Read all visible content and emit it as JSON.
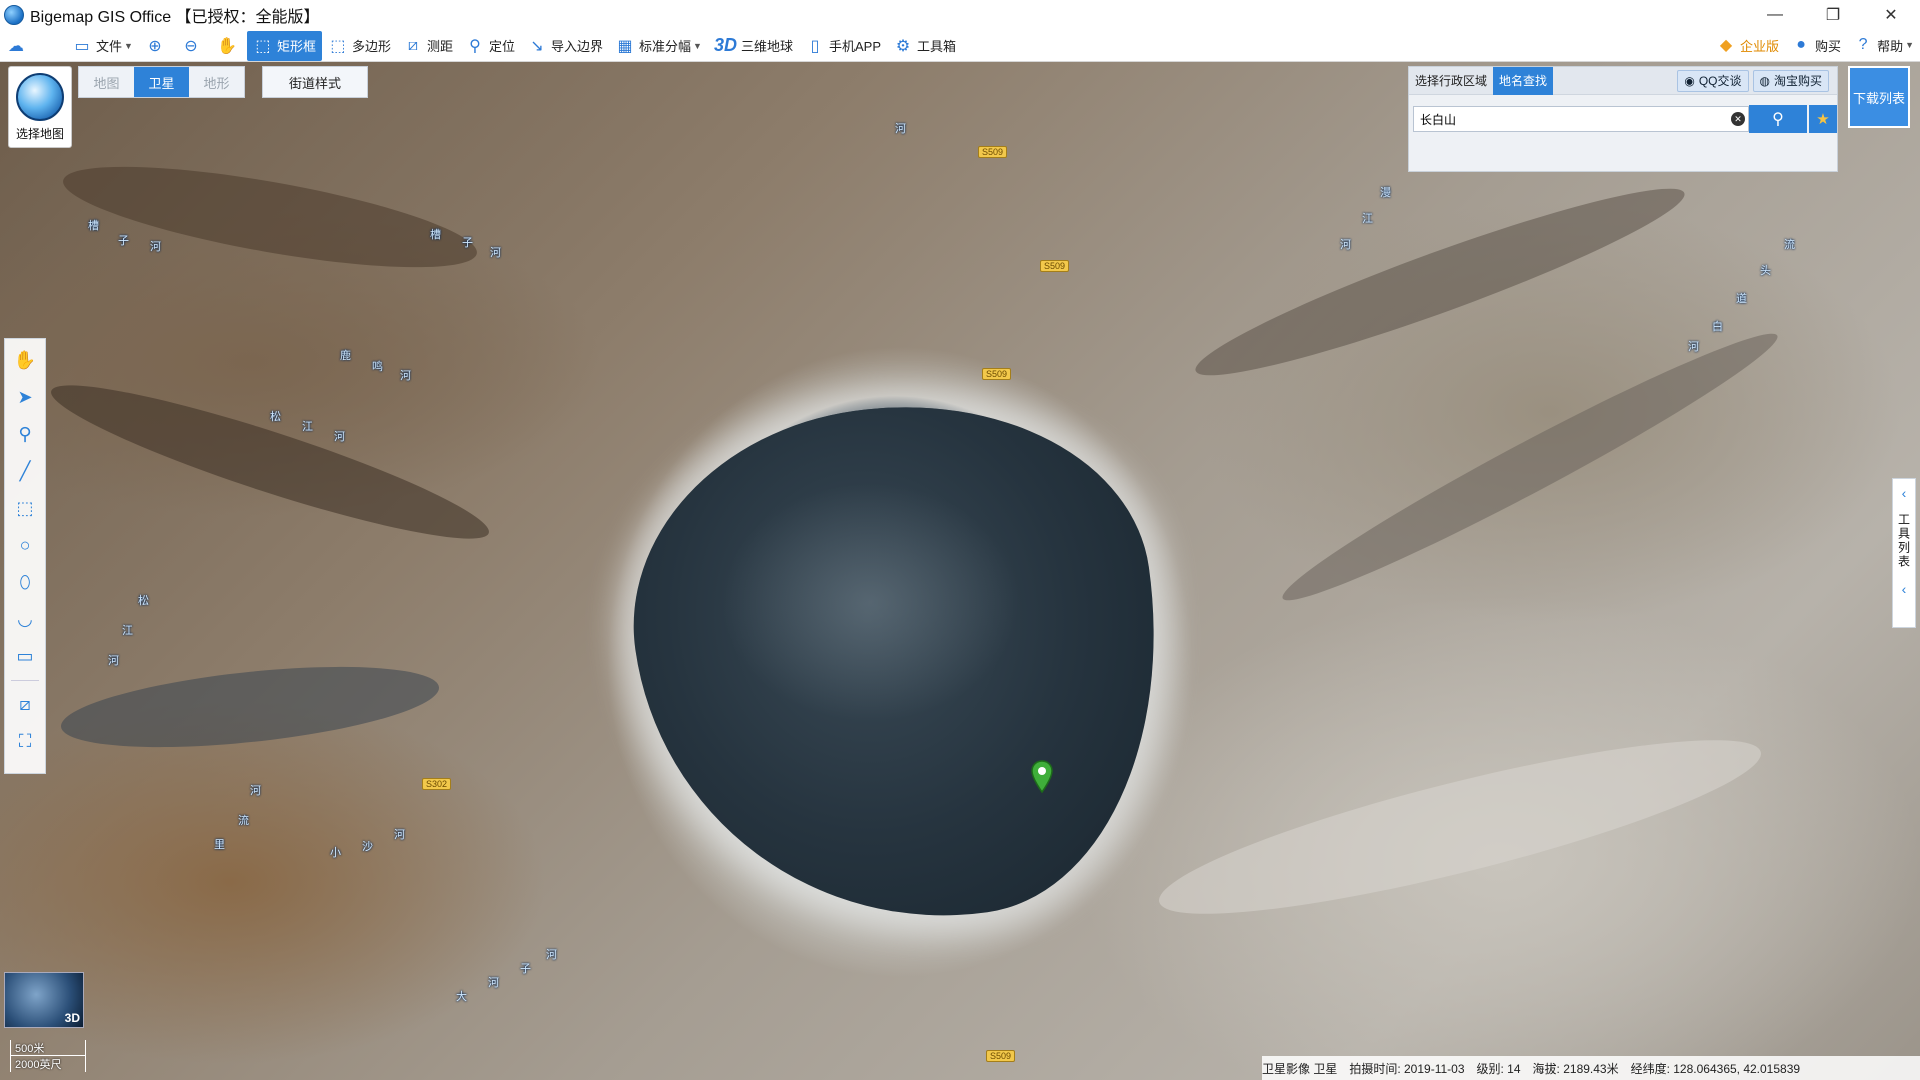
{
  "window": {
    "title": "Bigemap GIS Office 【已授权：全能版】",
    "minimize": "—",
    "maximize": "❐",
    "close": "✕"
  },
  "toolbar": {
    "file": "文件",
    "rect": "矩形框",
    "polygon": "多边形",
    "measure": "测距",
    "locate": "定位",
    "import_boundary": "导入边界",
    "standard_sheet": "标准分幅",
    "globe_3d": "三维地球",
    "globe_3d_prefix": "3D",
    "mobile_app": "手机APP",
    "toolbox": "工具箱",
    "enterprise": "企业版",
    "buy": "购买",
    "help": "帮助"
  },
  "map_type": {
    "select_label": "选择地图",
    "tabs": [
      "地图",
      "卫星",
      "地形"
    ],
    "active_tab": "卫星",
    "street_style": "街道样式"
  },
  "search_panel": {
    "tab_region": "选择行政区域",
    "tab_place": "地名查找",
    "qq": "QQ交谈",
    "taobao": "淘宝购买",
    "query": "长白山",
    "download_list": "下载列表"
  },
  "right_panel": {
    "label": "工具列表"
  },
  "map_labels": [
    "槽",
    "子",
    "河",
    "槽",
    "子",
    "河",
    "鹿",
    "鸣",
    "河",
    "松",
    "江",
    "河",
    "松",
    "江",
    "河",
    "河",
    "流",
    "里",
    "小",
    "沙",
    "河",
    "大",
    "河",
    "子",
    "河",
    "河",
    "漫",
    "江",
    "河",
    "流",
    "头",
    "道",
    "白",
    "河"
  ],
  "road_labels": [
    "S509",
    "S509",
    "S509",
    "S302",
    "S509"
  ],
  "minimap": {
    "tag": "3D"
  },
  "scale": {
    "metric": "500米",
    "imperial": "2000英尺"
  },
  "status": {
    "source": "卫星影像 卫星",
    "capture_date": "拍摄时间: 2019-11-03",
    "level": "级别:  14",
    "elevation": "海拔: 2189.43米",
    "coords": "经纬度:   128.064365, 42.015839"
  }
}
